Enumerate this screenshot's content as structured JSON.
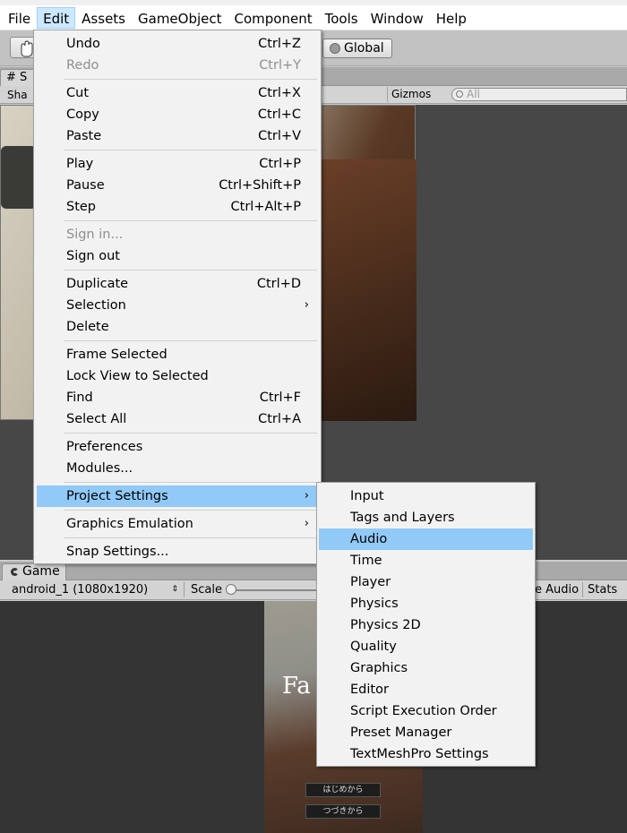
{
  "menubar": {
    "items": [
      "File",
      "Edit",
      "Assets",
      "GameObject",
      "Component",
      "Tools",
      "Window",
      "Help"
    ],
    "active": "Edit"
  },
  "toolbar": {
    "global_label": "Global"
  },
  "scene": {
    "tab_label": "S",
    "shaded_label": "Sha",
    "gizmos_label": "Gizmos",
    "search_placeholder": "All"
  },
  "game": {
    "tab_label": "Game",
    "resolution": "android_1 (1080x1920)",
    "scale_label": "Scale",
    "mute_label": "e Audio",
    "stats_label": "Stats",
    "title_text": "Fa",
    "buttons": [
      "はじめから",
      "つづきから"
    ]
  },
  "edit_menu": {
    "items": [
      {
        "label": "Undo",
        "shortcut": "Ctrl+Z"
      },
      {
        "label": "Redo",
        "shortcut": "Ctrl+Y",
        "disabled": true
      },
      {
        "label": "Cut",
        "shortcut": "Ctrl+X"
      },
      {
        "label": "Copy",
        "shortcut": "Ctrl+C"
      },
      {
        "label": "Paste",
        "shortcut": "Ctrl+V"
      },
      {
        "label": "Play",
        "shortcut": "Ctrl+P"
      },
      {
        "label": "Pause",
        "shortcut": "Ctrl+Shift+P"
      },
      {
        "label": "Step",
        "shortcut": "Ctrl+Alt+P"
      },
      {
        "label": "Sign in...",
        "shortcut": "",
        "disabled": true
      },
      {
        "label": "Sign out",
        "shortcut": ""
      },
      {
        "label": "Duplicate",
        "shortcut": "Ctrl+D"
      },
      {
        "label": "Selection",
        "shortcut": "",
        "submenu": true
      },
      {
        "label": "Delete",
        "shortcut": ""
      },
      {
        "label": "Frame Selected",
        "shortcut": ""
      },
      {
        "label": "Lock View to Selected",
        "shortcut": ""
      },
      {
        "label": "Find",
        "shortcut": "Ctrl+F"
      },
      {
        "label": "Select All",
        "shortcut": "Ctrl+A"
      },
      {
        "label": "Preferences",
        "shortcut": ""
      },
      {
        "label": "Modules...",
        "shortcut": ""
      },
      {
        "label": "Project Settings",
        "shortcut": "",
        "submenu": true,
        "highlighted": true
      },
      {
        "label": "Graphics Emulation",
        "shortcut": "",
        "submenu": true
      },
      {
        "label": "Snap Settings...",
        "shortcut": ""
      }
    ],
    "submenu_arrow": "›"
  },
  "project_settings_menu": {
    "items": [
      "Input",
      "Tags and Layers",
      "Audio",
      "Time",
      "Player",
      "Physics",
      "Physics 2D",
      "Quality",
      "Graphics",
      "Editor",
      "Script Execution Order",
      "Preset Manager",
      "TextMeshPro Settings"
    ],
    "highlighted": "Audio"
  },
  "colors": {
    "menu_highlight": "#91c9f7",
    "menubar_active": "#cce8ff",
    "editor_bg": "#474747"
  }
}
